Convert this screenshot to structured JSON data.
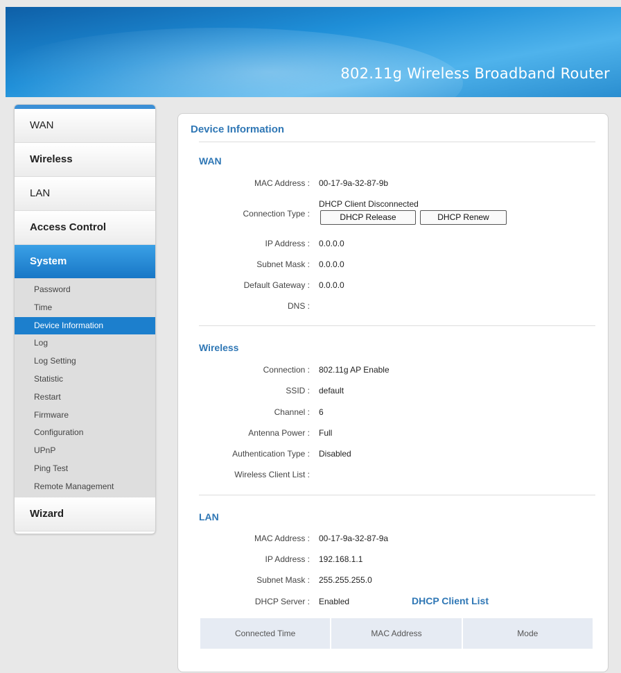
{
  "header": {
    "title": "802.11g Wireless Broadband Router"
  },
  "sidebar": {
    "items": [
      {
        "label": "WAN"
      },
      {
        "label": "Wireless"
      },
      {
        "label": "LAN"
      },
      {
        "label": "Access Control"
      },
      {
        "label": "System"
      },
      {
        "label": "Wizard"
      }
    ],
    "submenu": [
      "Password",
      "Time",
      "Device Information",
      "Log",
      "Log Setting",
      "Statistic",
      "Restart",
      "Firmware",
      "Configuration",
      "UPnP",
      "Ping Test",
      "Remote Management"
    ],
    "active_item": "System",
    "active_sub": "Device Information"
  },
  "content": {
    "title": "Device Information",
    "wan": {
      "title": "WAN",
      "mac_label": "MAC Address :",
      "mac": "00-17-9a-32-87-9b",
      "conn_label": "Connection Type :",
      "conn": "DHCP Client Disconnected",
      "release_btn": "DHCP Release",
      "renew_btn": "DHCP Renew",
      "ip_label": "IP Address :",
      "ip": "0.0.0.0",
      "mask_label": "Subnet Mask :",
      "mask": "0.0.0.0",
      "gw_label": "Default Gateway :",
      "gw": "0.0.0.0",
      "dns_label": "DNS :",
      "dns": ""
    },
    "wireless": {
      "title": "Wireless",
      "conn_label": "Connection :",
      "conn": "802.11g AP Enable",
      "ssid_label": "SSID :",
      "ssid": "default",
      "channel_label": "Channel :",
      "channel": "6",
      "power_label": "Antenna Power :",
      "power": "Full",
      "auth_label": "Authentication Type :",
      "auth": "Disabled",
      "clients_label": "Wireless Client List :",
      "clients": ""
    },
    "lan": {
      "title": "LAN",
      "mac_label": "MAC Address :",
      "mac": "00-17-9a-32-87-9a",
      "ip_label": "IP Address :",
      "ip": "192.168.1.1",
      "mask_label": "Subnet Mask :",
      "mask": "255.255.255.0",
      "dhcp_label": "DHCP Server :",
      "dhcp": "Enabled",
      "client_list_link": "DHCP Client List",
      "table_headers": [
        "Connected Time",
        "MAC Address",
        "Mode"
      ]
    }
  },
  "colors": {
    "accent": "#2f77b5",
    "active": "#1c7fcd",
    "header": "#1f8fd8"
  }
}
